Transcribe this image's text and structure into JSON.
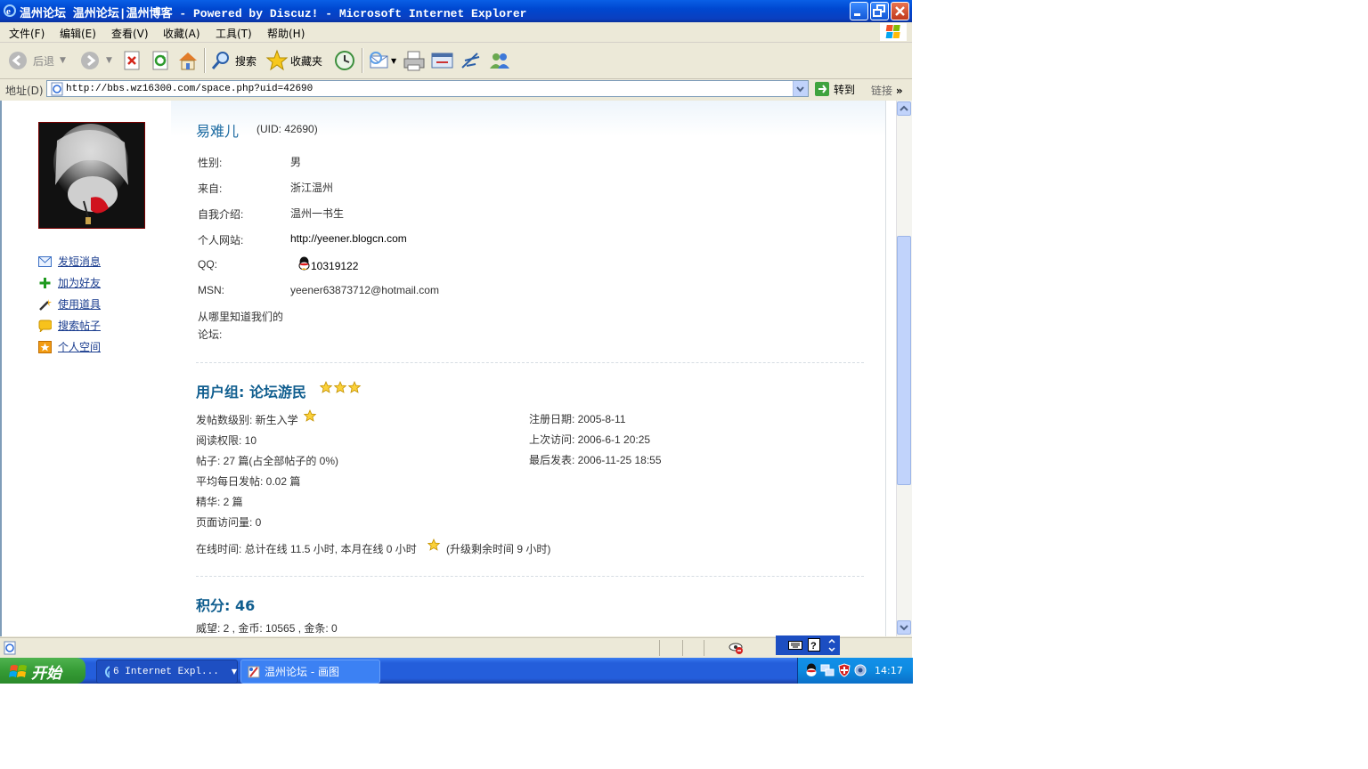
{
  "window": {
    "title": "温州论坛 温州论坛|温州博客 - Powered by Discuz! - Microsoft Internet Explorer"
  },
  "menu": [
    "文件(F)",
    "编辑(E)",
    "查看(V)",
    "收藏(A)",
    "工具(T)",
    "帮助(H)"
  ],
  "toolbar": {
    "back": "后退",
    "search": "搜索",
    "favorites": "收藏夹"
  },
  "address": {
    "label": "地址(D)",
    "url": "http://bbs.wz16300.com/space.php?uid=42690",
    "go": "转到",
    "links": "链接"
  },
  "sidebar": {
    "links": [
      "发短消息",
      "加为好友",
      "使用道具",
      "搜索帖子",
      "个人空间"
    ]
  },
  "profile": {
    "name": "易难儿",
    "uid": "(UID: 42690)",
    "fields": [
      {
        "label": "性别:",
        "value": "男"
      },
      {
        "label": "来自:",
        "value": "浙江温州"
      },
      {
        "label": "自我介绍:",
        "value": "温州一书生"
      },
      {
        "label": "个人网站:",
        "value": "http://yeener.blogcn.com"
      },
      {
        "label": "QQ:",
        "value": "10319122"
      },
      {
        "label": "MSN:",
        "value": "yeener63873712@hotmail.com"
      }
    ],
    "source_label_1": "从哪里知道我们的",
    "source_label_2": "论坛:"
  },
  "group": {
    "title": "用户组: 论坛游民",
    "stars": 3,
    "left": [
      "发帖数级别: 新生入学",
      "阅读权限: 10",
      "帖子: 27 篇(占全部帖子的  0%)",
      "平均每日发帖: 0.02 篇",
      "精华: 2 篇",
      "页面访问量: 0"
    ],
    "right": [
      "注册日期: 2005-8-11",
      "上次访问: 2006-6-1 20:25",
      "最后发表: 2006-11-25 18:55"
    ],
    "online_a": "在线时间: 总计在线  11.5 小时, 本月在线  0 小时",
    "online_b": "(升级剩余时间  9 小时)"
  },
  "points": {
    "title": "积分: 46",
    "detail": "威望: 2 , 金币: 10565 , 金条: 0"
  },
  "taskbar": {
    "start": "开始",
    "task1": "6 Internet Expl...",
    "task2": "温州论坛 - 画图",
    "clock": "14:17"
  }
}
